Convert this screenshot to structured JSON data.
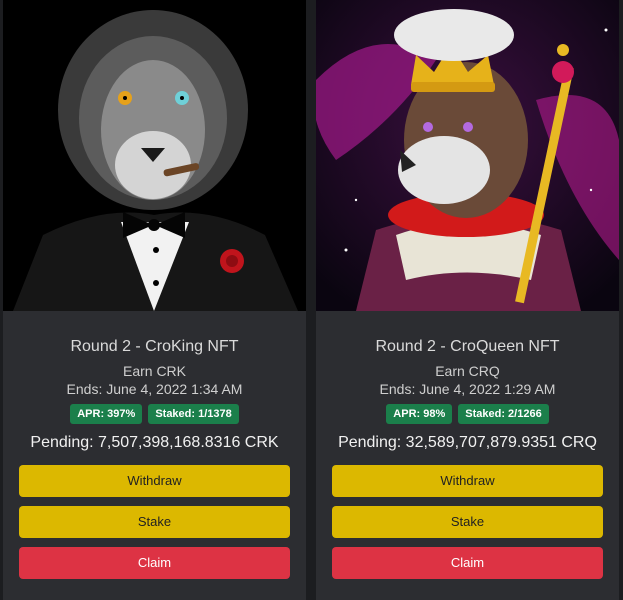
{
  "cards": [
    {
      "title": "Round 2 - CroKing NFT",
      "earn": "Earn CRK",
      "ends": "Ends: June 4, 2022 1:34 AM",
      "apr": "APR: 397%",
      "staked": "Staked: 1/1378",
      "pending": "Pending: 7,507,398,168.8316 CRK",
      "withdraw": "Withdraw",
      "stake": "Stake",
      "claim": "Claim"
    },
    {
      "title": "Round 2 - CroQueen NFT",
      "earn": "Earn CRQ",
      "ends": "Ends: June 4, 2022 1:29 AM",
      "apr": "APR: 98%",
      "staked": "Staked: 2/1266",
      "pending": "Pending: 32,589,707,879.9351 CRQ",
      "withdraw": "Withdraw",
      "stake": "Stake",
      "claim": "Claim"
    }
  ],
  "colors": {
    "badge": "#1b7f4b",
    "button_yellow": "#dcb800",
    "button_red": "#dd3344",
    "card_bg": "#2c2d31"
  }
}
